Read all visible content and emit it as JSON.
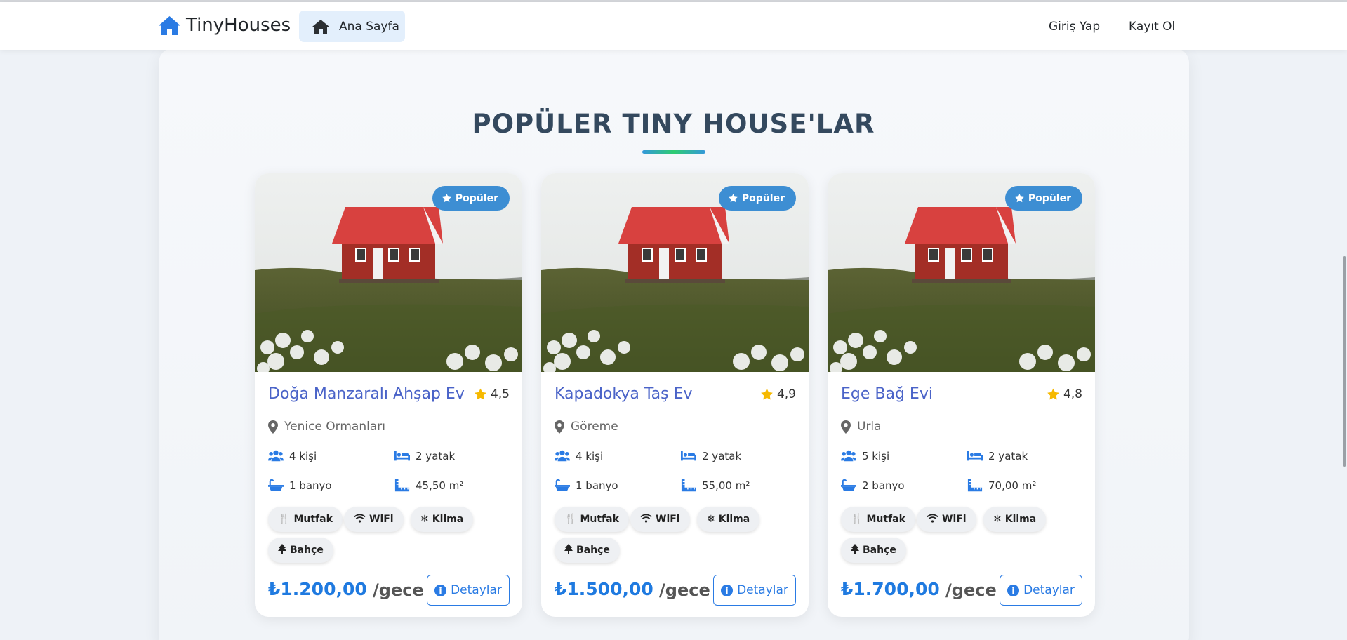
{
  "navbar": {
    "brand": "TinyHouses",
    "home": "Ana Sayfa",
    "login": "Giriş Yap",
    "register": "Kayıt Ol"
  },
  "section": {
    "title": "POPÜLER TINY HOUSE'LAR"
  },
  "colors": {
    "accent": "#1f7ae0",
    "badge": "#3d8ed3",
    "title": "#4a63c8",
    "star": "#f6b900"
  },
  "cards": [
    {
      "badge": "Popüler",
      "title": "Doğa Manzaralı Ahşap Ev",
      "rating": "4,5",
      "location": "Yenice Ormanları",
      "guests": "4 kişi",
      "beds": "2 yatak",
      "baths": "1 banyo",
      "area": "45,50 m²",
      "amenities": [
        "Mutfak",
        "WiFi",
        "Klima",
        "Bahçe"
      ],
      "price": "₺1.200,00",
      "per": "/gece",
      "details": "Detaylar"
    },
    {
      "badge": "Popüler",
      "title": "Kapadokya Taş Ev",
      "rating": "4,9",
      "location": "Göreme",
      "guests": "4 kişi",
      "beds": "2 yatak",
      "baths": "1 banyo",
      "area": "55,00 m²",
      "amenities": [
        "Mutfak",
        "WiFi",
        "Klima",
        "Bahçe"
      ],
      "price": "₺1.500,00",
      "per": "/gece",
      "details": "Detaylar"
    },
    {
      "badge": "Popüler",
      "title": "Ege Bağ Evi",
      "rating": "4,8",
      "location": "Urla",
      "guests": "5 kişi",
      "beds": "2 yatak",
      "baths": "2 banyo",
      "area": "70,00 m²",
      "amenities": [
        "Mutfak",
        "WiFi",
        "Klima",
        "Bahçe"
      ],
      "price": "₺1.700,00",
      "per": "/gece",
      "details": "Detaylar"
    }
  ]
}
